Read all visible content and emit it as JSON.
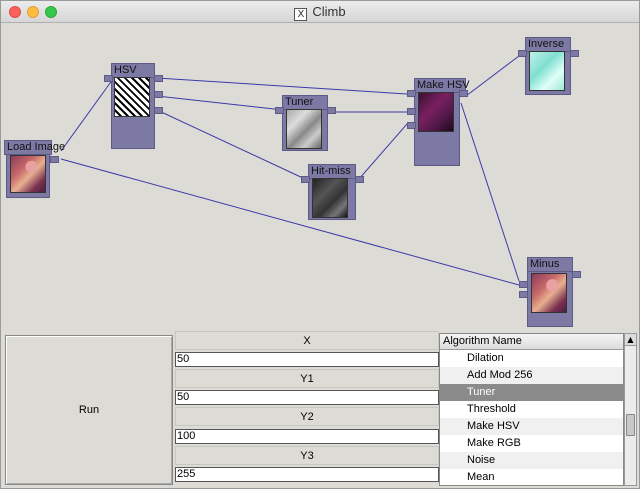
{
  "window": {
    "title": "Climb",
    "title_icon": "X"
  },
  "nodes": {
    "load_image": "Load Image",
    "hsv": "HSV",
    "tuner": "Tuner",
    "hit_miss": "Hit-miss",
    "make_hsv": "Make HSV",
    "inverse": "Inverse",
    "minus": "Minus"
  },
  "link_color": "#3a3aa8",
  "node_color": "#7c7aa4",
  "controls": {
    "run_label": "Run",
    "fields": [
      {
        "label": "X",
        "value": "50"
      },
      {
        "label": "Y1",
        "value": "50"
      },
      {
        "label": "Y2",
        "value": "100"
      },
      {
        "label": "Y3",
        "value": "255"
      }
    ]
  },
  "algorithm_list": {
    "header": "Algorithm Name",
    "items": [
      "Dilation",
      "Add Mod 256",
      "Tuner",
      "Threshold",
      "Make HSV",
      "Make RGB",
      "Noise",
      "Mean"
    ],
    "selected": "Tuner"
  },
  "icons": {
    "scroll_up": "▲"
  }
}
